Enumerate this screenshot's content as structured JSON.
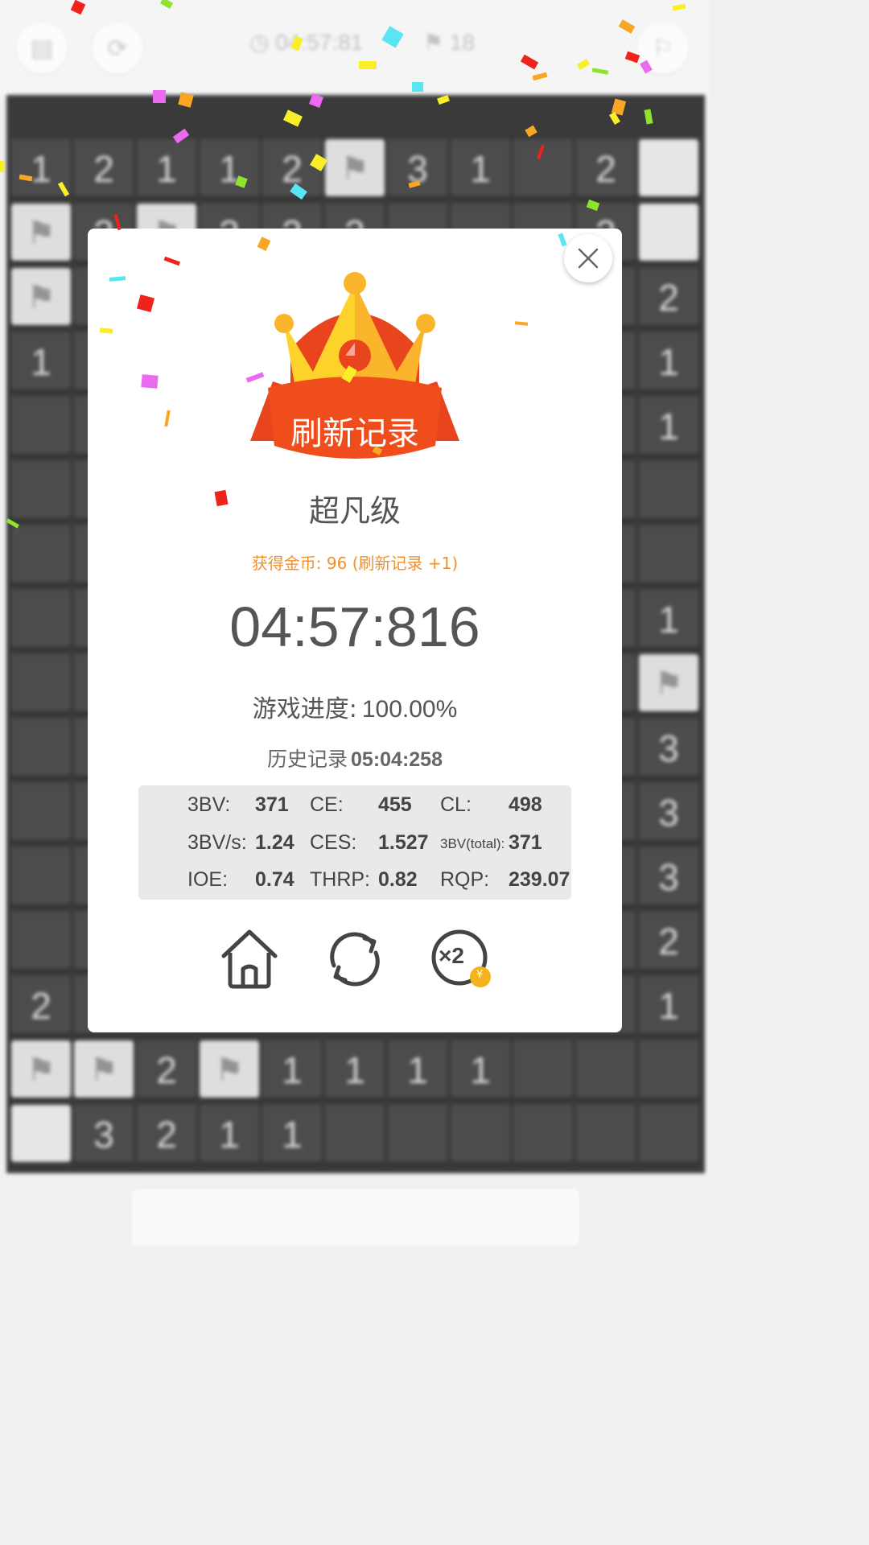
{
  "topbar": {
    "timer": "04:57:81",
    "flags_left": "18"
  },
  "board": {
    "rows": [
      [
        "1",
        "2",
        "1",
        "1",
        "2",
        "F",
        "3",
        "1",
        "",
        "2",
        "L"
      ],
      [
        "F",
        "3",
        "F",
        "3",
        "3",
        "3",
        "",
        "",
        "",
        "3",
        "L"
      ],
      [
        "F",
        "",
        "",
        "",
        "",
        "",
        "",
        "",
        "",
        "",
        "2"
      ],
      [
        "1",
        "",
        "",
        "",
        "",
        "",
        "",
        "",
        "",
        "",
        "1"
      ],
      [
        "",
        "",
        "",
        "",
        "",
        "",
        "",
        "",
        "",
        "",
        "1"
      ],
      [
        "",
        "",
        "",
        "",
        "",
        "",
        "",
        "",
        "",
        "",
        ""
      ],
      [
        "",
        "",
        "",
        "",
        "",
        "",
        "",
        "",
        "",
        "",
        ""
      ],
      [
        "",
        "",
        "",
        "",
        "",
        "",
        "",
        "",
        "",
        "",
        "1"
      ],
      [
        "",
        "",
        "",
        "",
        "",
        "",
        "",
        "",
        "",
        "",
        "F"
      ],
      [
        "",
        "",
        "",
        "",
        "",
        "",
        "",
        "",
        "",
        "",
        "3"
      ],
      [
        "",
        "",
        "",
        "",
        "",
        "",
        "",
        "",
        "",
        "",
        "3"
      ],
      [
        "",
        "",
        "",
        "",
        "",
        "",
        "",
        "",
        "",
        "",
        "3"
      ],
      [
        "",
        "",
        "",
        "",
        "",
        "",
        "",
        "",
        "",
        "",
        "2"
      ],
      [
        "2",
        "",
        "",
        "",
        "",
        "",
        "",
        "",
        "",
        "",
        "1"
      ],
      [
        "F",
        "F",
        "2",
        "F",
        "1",
        "1",
        "1",
        "1",
        "",
        "",
        ""
      ],
      [
        "L",
        "3",
        "2",
        "1",
        "1",
        "",
        "",
        "",
        "",
        "",
        ""
      ]
    ]
  },
  "dialog": {
    "banner": "刷新记录",
    "level": "超凡级",
    "coins": "获得金币: 96 (刷新记录 +1)",
    "time": "04:57:816",
    "progress_label": "游戏进度:",
    "progress_value": "100.00%",
    "progress_fraction": 1.0,
    "history_label": "历史记录",
    "history_value": "05:04:258",
    "stats": [
      [
        {
          "label": "3BV:",
          "value": "371"
        },
        {
          "label": "CE:",
          "value": "455"
        },
        {
          "label": "CL:",
          "value": "498"
        }
      ],
      [
        {
          "label": "3BV/s:",
          "value": "1.24"
        },
        {
          "label": "CES:",
          "value": "1.527"
        },
        {
          "label": "3BV(total):",
          "value": "371"
        }
      ],
      [
        {
          "label": "IOE:",
          "value": "0.74"
        },
        {
          "label": "THRP:",
          "value": "0.82"
        },
        {
          "label": "RQP:",
          "value": "239.07"
        }
      ]
    ],
    "buttons": {
      "home_icon": "home-icon",
      "restart_icon": "restart-icon",
      "double_icon": "double-reward-icon",
      "double_label": "×2",
      "coin_symbol": "¥"
    }
  },
  "colors": {
    "accent_orange": "#f0922b",
    "ribbon_red": "#e8451e",
    "crown_gold": "#fbb52d",
    "coin_gold": "#f5b21b"
  }
}
